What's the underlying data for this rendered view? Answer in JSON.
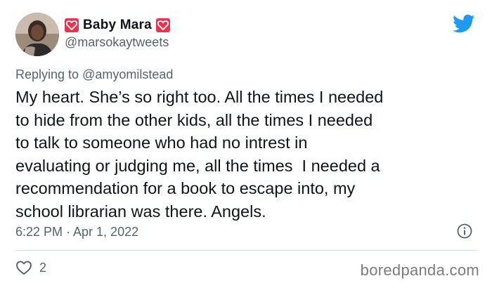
{
  "tweet": {
    "display_name": "Baby Mara",
    "handle": "@marsokaytweets",
    "replying_prefix": "Replying to ",
    "replying_to": "@amyomilstead",
    "text": "My heart. She’s so right too. All the times I needed\nto hide from the other kids, all the times I needed\nto talk to someone who had no intrest in\nevaluating or judging me, all the times  I needed a\nrecommendation for a book to escape into, my\nschool librarian was there. Angels.",
    "timestamp": "6:22 PM · Apr 1, 2022",
    "like_count": "2"
  },
  "icons": {
    "name_badge": "heart-badge-icon",
    "brand": "twitter-bird-icon",
    "info": "info-icon",
    "like": "heart-outline-icon"
  },
  "watermark": "boredpanda.com",
  "colors": {
    "twitter_blue": "#1d9bf0",
    "badge_red": "#e8354f",
    "secondary_text": "#536471",
    "primary_text": "#0f1419"
  }
}
